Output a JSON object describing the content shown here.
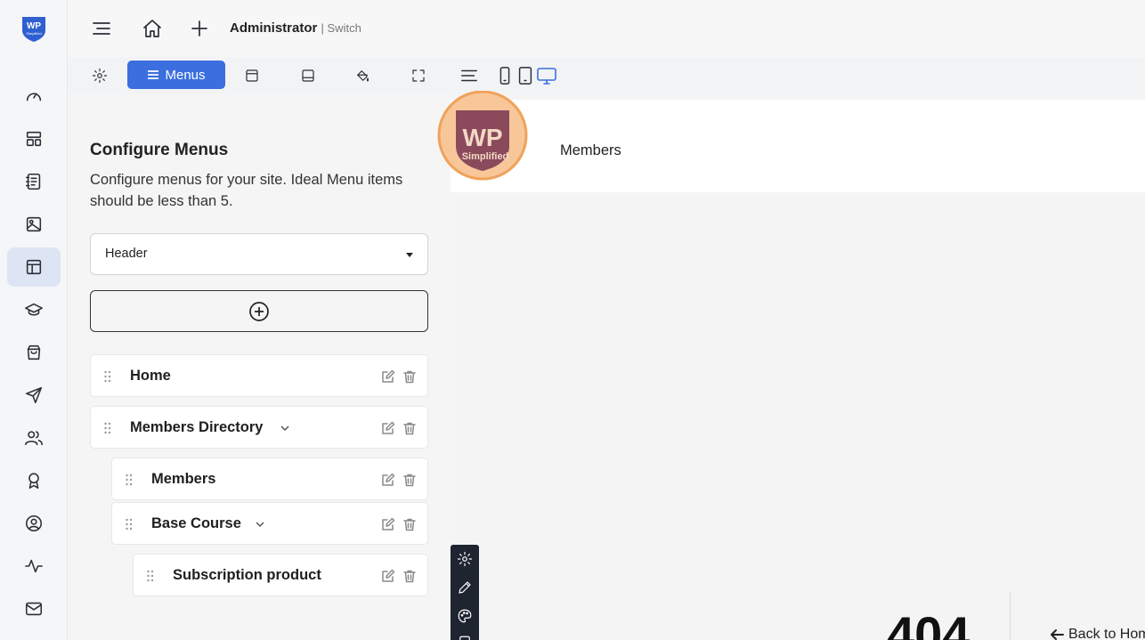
{
  "brand": {
    "logo_text": "WP"
  },
  "rail": {
    "items": [
      {
        "icon": "dashboard-gauge-icon"
      },
      {
        "icon": "layout-icon"
      },
      {
        "icon": "notebook-icon"
      },
      {
        "icon": "image-icon"
      },
      {
        "icon": "template-icon",
        "active": true
      },
      {
        "icon": "graduation-cap-icon"
      },
      {
        "icon": "shopping-bag-icon"
      },
      {
        "icon": "send-icon"
      },
      {
        "icon": "users-icon"
      },
      {
        "icon": "award-icon"
      },
      {
        "icon": "user-circle-icon"
      },
      {
        "icon": "activity-icon"
      },
      {
        "icon": "mail-icon"
      }
    ]
  },
  "topbar": {
    "user_name": "Administrator",
    "switch_label": "| Switch"
  },
  "toolbar": {
    "menus_label": "Menus"
  },
  "panel": {
    "title": "Configure Menus",
    "description": "Configure menus for your site. Ideal Menu items should be less than 5.",
    "select_value": "Header",
    "menu_items": [
      {
        "label": "Home"
      },
      {
        "label": "Members Directory",
        "has_children": true
      },
      {
        "label": "Members"
      },
      {
        "label": "Base Course",
        "has_children": true
      },
      {
        "label": "Subscription product"
      }
    ]
  },
  "preview": {
    "logo_text": "WP",
    "logo_subtext": "Simplified",
    "nav_item": "Members",
    "error_code": "404",
    "back_link": "Back to Hom"
  },
  "colors": {
    "accent": "#3b6fe0",
    "logo_orange": "#f0a25a",
    "logo_maroon": "#8a4a5c"
  }
}
